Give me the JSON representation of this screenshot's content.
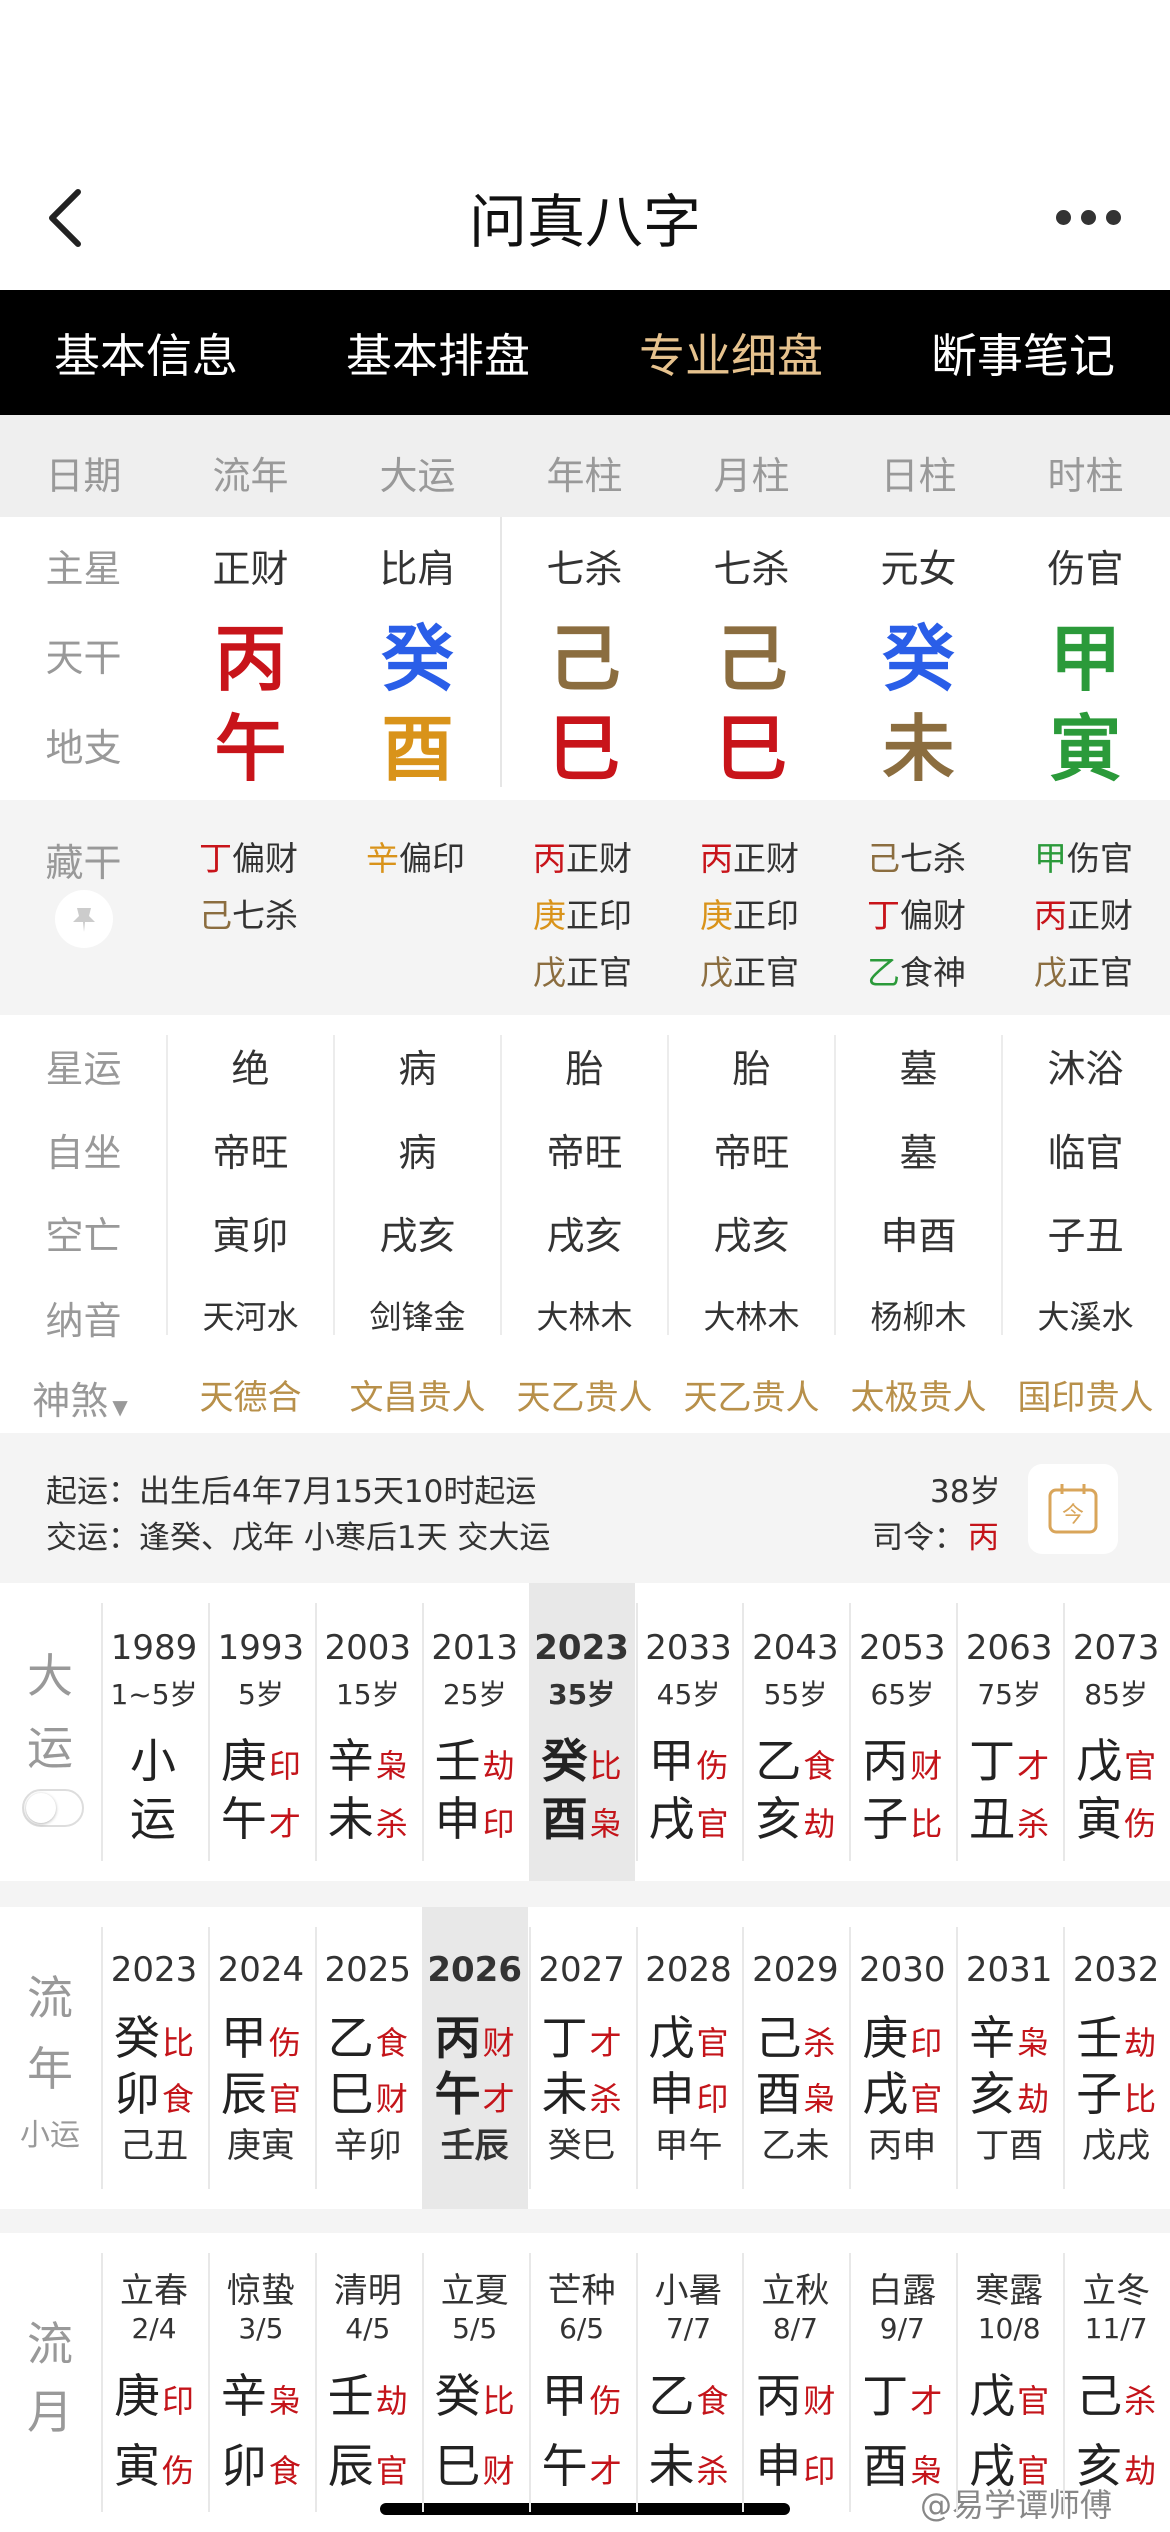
{
  "app": {
    "title": "问真八字"
  },
  "tabs": [
    "基本信息",
    "基本排盘",
    "专业细盘",
    "断事笔记"
  ],
  "header_cols": [
    "日期",
    "流年",
    "大运",
    "年柱",
    "月柱",
    "日柱",
    "时柱"
  ],
  "row_labels": {
    "zhuxing": "主星",
    "tiangan": "天干",
    "dizhi": "地支",
    "canggan": "藏干",
    "xingyun": "星运",
    "zizuo": "自坐",
    "kongwang": "空亡",
    "nayin": "纳音",
    "shensha": "神煞"
  },
  "zhuxing": [
    "正财",
    "比肩",
    "七杀",
    "七杀",
    "元女",
    "伤官"
  ],
  "tiangan": [
    {
      "c": "丙",
      "color": "#c8141a"
    },
    {
      "c": "癸",
      "color": "#2a5ee8"
    },
    {
      "c": "己",
      "color": "#8b6d3f"
    },
    {
      "c": "己",
      "color": "#8b6d3f"
    },
    {
      "c": "癸",
      "color": "#2a5ee8"
    },
    {
      "c": "甲",
      "color": "#2b9a3a"
    }
  ],
  "dizhi": [
    {
      "c": "午",
      "color": "#c8141a"
    },
    {
      "c": "酉",
      "color": "#d9931a"
    },
    {
      "c": "巳",
      "color": "#c8141a"
    },
    {
      "c": "巳",
      "color": "#c8141a"
    },
    {
      "c": "未",
      "color": "#8b6d3f"
    },
    {
      "c": "寅",
      "color": "#2b9a3a"
    }
  ],
  "canggan": [
    [
      {
        "g": "丁",
        "color": "#c8141a",
        "s": "偏财"
      },
      {
        "g": "己",
        "color": "#8b6d3f",
        "s": "七杀"
      }
    ],
    [
      {
        "g": "辛",
        "color": "#d9931a",
        "s": "偏印"
      }
    ],
    [
      {
        "g": "丙",
        "color": "#c8141a",
        "s": "正财"
      },
      {
        "g": "庚",
        "color": "#d9931a",
        "s": "正印"
      },
      {
        "g": "戊",
        "color": "#8b6d3f",
        "s": "正官"
      }
    ],
    [
      {
        "g": "丙",
        "color": "#c8141a",
        "s": "正财"
      },
      {
        "g": "庚",
        "color": "#d9931a",
        "s": "正印"
      },
      {
        "g": "戊",
        "color": "#8b6d3f",
        "s": "正官"
      }
    ],
    [
      {
        "g": "己",
        "color": "#8b6d3f",
        "s": "七杀"
      },
      {
        "g": "丁",
        "color": "#c8141a",
        "s": "偏财"
      },
      {
        "g": "乙",
        "color": "#2b9a3a",
        "s": "食神"
      }
    ],
    [
      {
        "g": "甲",
        "color": "#2b9a3a",
        "s": "伤官"
      },
      {
        "g": "丙",
        "color": "#c8141a",
        "s": "正财"
      },
      {
        "g": "戊",
        "color": "#8b6d3f",
        "s": "正官"
      }
    ]
  ],
  "xingyun": [
    "绝",
    "病",
    "胎",
    "胎",
    "墓",
    "沐浴"
  ],
  "zizuo": [
    "帝旺",
    "病",
    "帝旺",
    "帝旺",
    "墓",
    "临官"
  ],
  "kongwang": [
    "寅卯",
    "戌亥",
    "戌亥",
    "戌亥",
    "申酉",
    "子丑"
  ],
  "nayin": [
    "天河水",
    "剑锋金",
    "大林木",
    "大林木",
    "杨柳木",
    "大溪水"
  ],
  "shensha": [
    "天德合",
    "文昌贵人",
    "天乙贵人",
    "天乙贵人",
    "太极贵人",
    "国印贵人"
  ],
  "qiyun": {
    "line1": "起运：出生后4年7月15天10时起运",
    "line2": "交运：逢癸、戊年 小寒后1天 交大运",
    "age": "38岁",
    "siling_label": "司令：",
    "siling_value": "丙"
  },
  "dayun": {
    "label1": "大",
    "label2": "运",
    "cols": [
      {
        "year": "1989",
        "age": "1~5岁",
        "g": "小",
        "gt": "",
        "z": "运",
        "zt": ""
      },
      {
        "year": "1993",
        "age": "5岁",
        "g": "庚",
        "gt": "印",
        "z": "午",
        "zt": "才"
      },
      {
        "year": "2003",
        "age": "15岁",
        "g": "辛",
        "gt": "枭",
        "z": "未",
        "zt": "杀"
      },
      {
        "year": "2013",
        "age": "25岁",
        "g": "壬",
        "gt": "劫",
        "z": "申",
        "zt": "印"
      },
      {
        "year": "2023",
        "age": "35岁",
        "g": "癸",
        "gt": "比",
        "z": "酉",
        "zt": "枭"
      },
      {
        "year": "2033",
        "age": "45岁",
        "g": "甲",
        "gt": "伤",
        "z": "戌",
        "zt": "官"
      },
      {
        "year": "2043",
        "age": "55岁",
        "g": "乙",
        "gt": "食",
        "z": "亥",
        "zt": "劫"
      },
      {
        "year": "2053",
        "age": "65岁",
        "g": "丙",
        "gt": "财",
        "z": "子",
        "zt": "比"
      },
      {
        "year": "2063",
        "age": "75岁",
        "g": "丁",
        "gt": "才",
        "z": "丑",
        "zt": "杀"
      },
      {
        "year": "2073",
        "age": "85岁",
        "g": "戊",
        "gt": "官",
        "z": "寅",
        "zt": "伤"
      }
    ]
  },
  "liunian": {
    "label1": "流",
    "label2": "年",
    "label3": "小运",
    "cols": [
      {
        "year": "2023",
        "g": "癸",
        "gt": "比",
        "z": "卯",
        "zt": "食",
        "x": "己丑"
      },
      {
        "year": "2024",
        "g": "甲",
        "gt": "伤",
        "z": "辰",
        "zt": "官",
        "x": "庚寅"
      },
      {
        "year": "2025",
        "g": "乙",
        "gt": "食",
        "z": "巳",
        "zt": "财",
        "x": "辛卯"
      },
      {
        "year": "2026",
        "g": "丙",
        "gt": "财",
        "z": "午",
        "zt": "才",
        "x": "壬辰"
      },
      {
        "year": "2027",
        "g": "丁",
        "gt": "才",
        "z": "未",
        "zt": "杀",
        "x": "癸巳"
      },
      {
        "year": "2028",
        "g": "戊",
        "gt": "官",
        "z": "申",
        "zt": "印",
        "x": "甲午"
      },
      {
        "year": "2029",
        "g": "己",
        "gt": "杀",
        "z": "酉",
        "zt": "枭",
        "x": "乙未"
      },
      {
        "year": "2030",
        "g": "庚",
        "gt": "印",
        "z": "戌",
        "zt": "官",
        "x": "丙申"
      },
      {
        "year": "2031",
        "g": "辛",
        "gt": "枭",
        "z": "亥",
        "zt": "劫",
        "x": "丁酉"
      },
      {
        "year": "2032",
        "g": "壬",
        "gt": "劫",
        "z": "子",
        "zt": "比",
        "x": "戊戌"
      }
    ]
  },
  "liuyue": {
    "label1": "流",
    "label2": "月",
    "cols": [
      {
        "jq": "立春",
        "d": "2/4",
        "g": "庚",
        "gt": "印",
        "z": "寅",
        "zt": "伤"
      },
      {
        "jq": "惊蛰",
        "d": "3/5",
        "g": "辛",
        "gt": "枭",
        "z": "卯",
        "zt": "食"
      },
      {
        "jq": "清明",
        "d": "4/5",
        "g": "壬",
        "gt": "劫",
        "z": "辰",
        "zt": "官"
      },
      {
        "jq": "立夏",
        "d": "5/5",
        "g": "癸",
        "gt": "比",
        "z": "巳",
        "zt": "财"
      },
      {
        "jq": "芒种",
        "d": "6/5",
        "g": "甲",
        "gt": "伤",
        "z": "午",
        "zt": "才"
      },
      {
        "jq": "小暑",
        "d": "7/7",
        "g": "乙",
        "gt": "食",
        "z": "未",
        "zt": "杀"
      },
      {
        "jq": "立秋",
        "d": "8/7",
        "g": "丙",
        "gt": "财",
        "z": "申",
        "zt": "印"
      },
      {
        "jq": "白露",
        "d": "9/7",
        "g": "丁",
        "gt": "才",
        "z": "酉",
        "zt": "枭"
      },
      {
        "jq": "寒露",
        "d": "10/8",
        "g": "戊",
        "gt": "官",
        "z": "戌",
        "zt": "官"
      },
      {
        "jq": "立冬",
        "d": "11/7",
        "g": "己",
        "gt": "杀",
        "z": "亥",
        "zt": "劫"
      }
    ]
  },
  "watermark": "@易学谭师傅"
}
